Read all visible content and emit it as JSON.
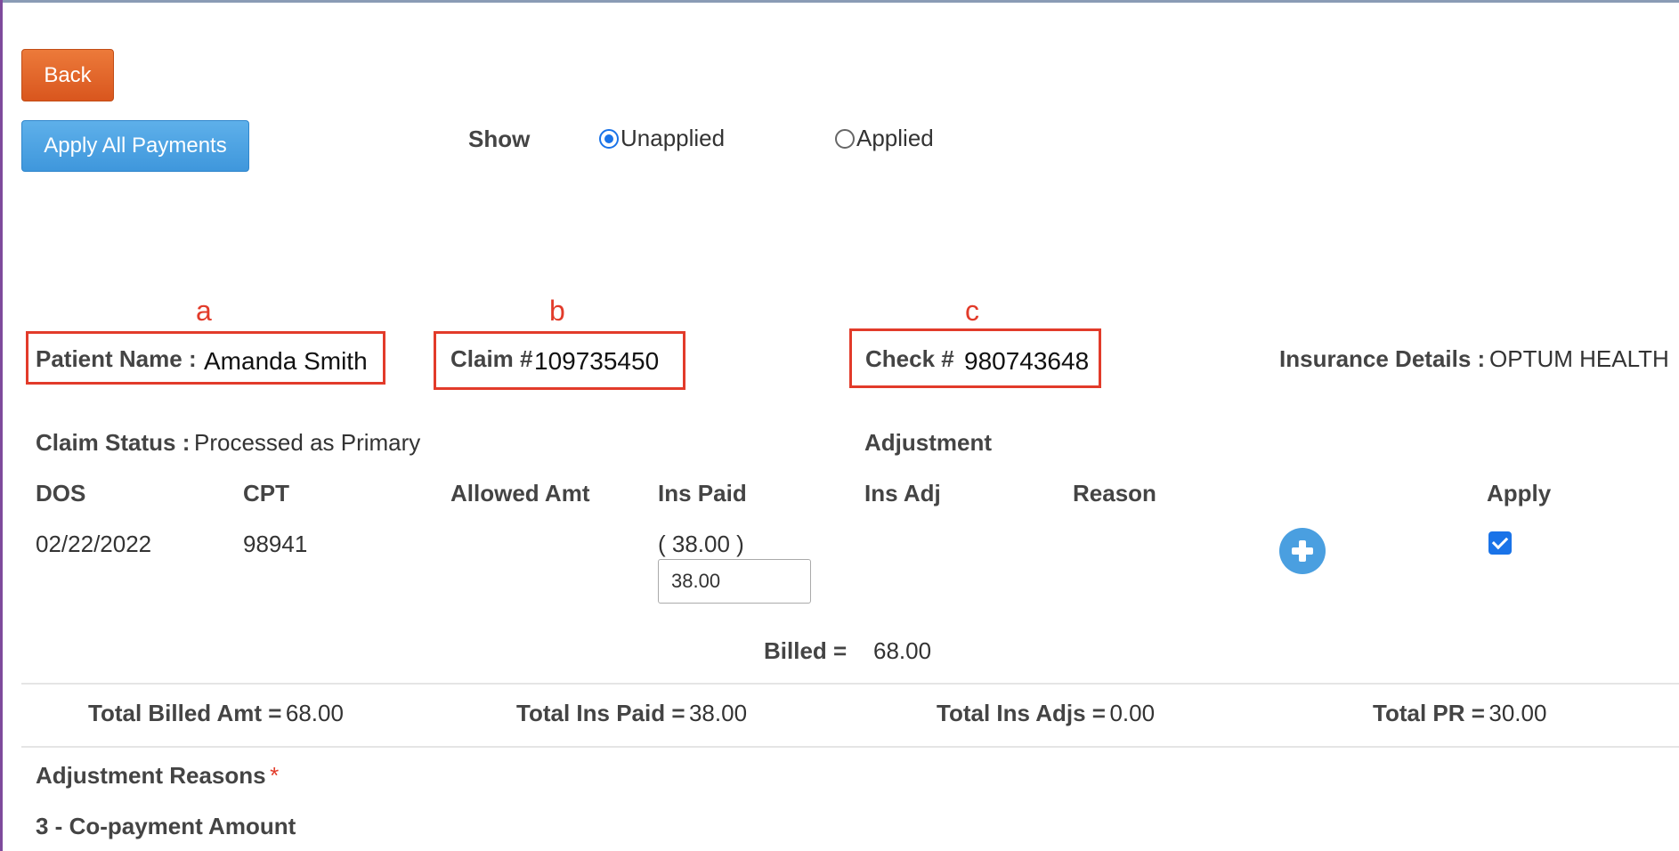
{
  "buttons": {
    "back": "Back",
    "apply_all": "Apply All Payments"
  },
  "show_filter": {
    "label": "Show",
    "options": [
      "Unapplied",
      "Applied"
    ],
    "selected": "Unapplied"
  },
  "annotations": {
    "a": "a",
    "b": "b",
    "c": "c",
    "box_color": "#e23b2a"
  },
  "patient": {
    "label": "Patient Name :",
    "value": "Amanda Smith"
  },
  "claim": {
    "label": "Claim #",
    "value": "109735450"
  },
  "check": {
    "label": "Check #",
    "value": "980743648"
  },
  "insurance": {
    "label": "Insurance Details :",
    "value": "OPTUM HEALTH"
  },
  "claim_status": {
    "label": "Claim Status :",
    "value": "Processed as Primary"
  },
  "adjustment_header": "Adjustment",
  "columns": [
    "DOS",
    "CPT",
    "Allowed Amt",
    "Ins Paid",
    "Ins Adj",
    "Reason",
    "Apply"
  ],
  "row": {
    "dos": "02/22/2022",
    "cpt": "98941",
    "ins_paid_display": "( 38.00 )",
    "ins_paid_input": "38.00",
    "apply_checked": true
  },
  "billed": {
    "label": "Billed =",
    "value": "68.00"
  },
  "totals": {
    "billed_label": "Total Billed Amt =",
    "billed_value": "68.00",
    "ins_paid_label": "Total Ins Paid =",
    "ins_paid_value": "38.00",
    "ins_adjs_label": "Total Ins Adjs =",
    "ins_adjs_value": "0.00",
    "pr_label": "Total PR =",
    "pr_value": "30.00"
  },
  "adjustment_reasons": {
    "label": "Adjustment Reasons",
    "required_mark": "*",
    "item": "3 - Co-payment Amount"
  },
  "colors": {
    "back_button": "#e06a2c",
    "apply_button": "#4aa3e6",
    "accent": "#1a73e8",
    "plus_button": "#4a9fe0"
  }
}
